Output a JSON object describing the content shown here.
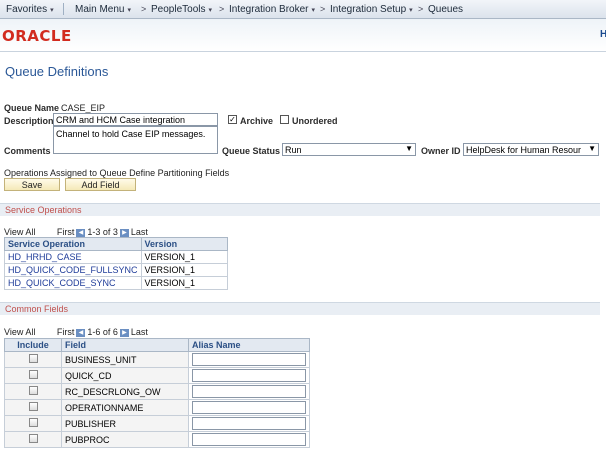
{
  "navbar": {
    "favorites": "Favorites",
    "main_menu": "Main Menu",
    "peopletools": "PeopleTools",
    "integration_broker": "Integration Broker",
    "integration_setup": "Integration Setup",
    "queues": "Queues",
    "chevron": ">"
  },
  "header": {
    "logo": "ORACLE",
    "right_link": "H"
  },
  "page": {
    "title": "Queue Definitions"
  },
  "form": {
    "queue_name_label": "Queue Name",
    "queue_name": "CASE_EIP",
    "description_label": "Description",
    "description": "CRM and HCM Case integration",
    "archive_label": "Archive",
    "archive_checked": true,
    "archive_mark": "✓",
    "unordered_label": "Unordered",
    "unordered_checked": false,
    "comments_label": "Comments",
    "comments": "Channel to hold Case EIP messages.",
    "queue_status_label": "Queue Status",
    "queue_status": "Run",
    "owner_id_label": "Owner ID",
    "owner_id": "HelpDesk for Human Resour",
    "operations_text": "Operations Assigned to Queue Define Partitioning Fields",
    "save_label": "Save",
    "add_field_label": "Add Field"
  },
  "service_operations": {
    "title": "Service Operations",
    "view_all": "View All",
    "first": "First",
    "range": "1-3 of 3",
    "last": "Last",
    "columns": [
      "Service Operation",
      "Version"
    ],
    "rows": [
      [
        "HD_HRHD_CASE",
        "VERSION_1"
      ],
      [
        "HD_QUICK_CODE_FULLSYNC",
        "VERSION_1"
      ],
      [
        "HD_QUICK_CODE_SYNC",
        "VERSION_1"
      ]
    ]
  },
  "common_fields": {
    "title": "Common Fields",
    "view_all": "View All",
    "first": "First",
    "range": "1-6 of 6",
    "last": "Last",
    "columns": [
      "Include",
      "Field",
      "Alias Name"
    ],
    "rows": [
      "BUSINESS_UNIT",
      "QUICK_CD",
      "RC_DESCRLONG_OW",
      "OPERATIONNAME",
      "PUBLISHER",
      "PUBPROC"
    ]
  },
  "icons": {
    "dropdown": "▾",
    "select_arrow": "▼",
    "prev": "◀",
    "next": "▶"
  }
}
